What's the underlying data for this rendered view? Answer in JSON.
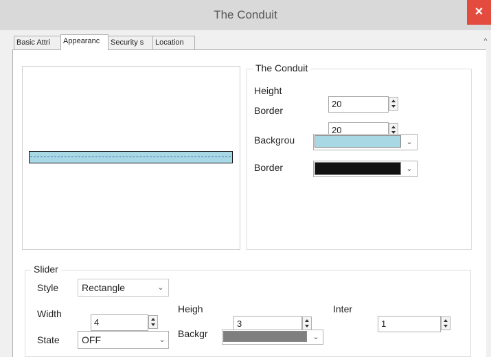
{
  "window": {
    "title": "The Conduit",
    "close_glyph": "×"
  },
  "tabs": [
    {
      "label": "Basic Attri"
    },
    {
      "label": "Appearanc"
    },
    {
      "label": "Security s"
    },
    {
      "label": "Location"
    }
  ],
  "scroll_up_glyph": "^",
  "conduit_group": {
    "legend": "The Conduit",
    "height_label": "Height",
    "height_value": "20",
    "border_label": "Border",
    "border_value": "20",
    "background_label": "Backgrou",
    "background_color": "#a9d8e5",
    "border_color_label": "Border",
    "border_color": "#111111"
  },
  "slider_group": {
    "legend": "Slider",
    "style_label": "Style",
    "style_value": "Rectangle",
    "width_label": "Width",
    "width_value": "4",
    "state_label": "State",
    "state_value": "OFF",
    "height_label": "Heigh",
    "height_value": "3",
    "background_label": "Backgr",
    "background_color": "#7f7f7f",
    "interval_label": "Inter",
    "interval_value": "1"
  },
  "preview": {
    "conduit_color": "#a9d8e5",
    "dash_color": "#3a6fb5"
  },
  "icons": {
    "close": "close-icon",
    "dropdown": "chevron-down-icon",
    "spin": "spin-arrows-icon"
  },
  "chevron_glyph": "⌄"
}
